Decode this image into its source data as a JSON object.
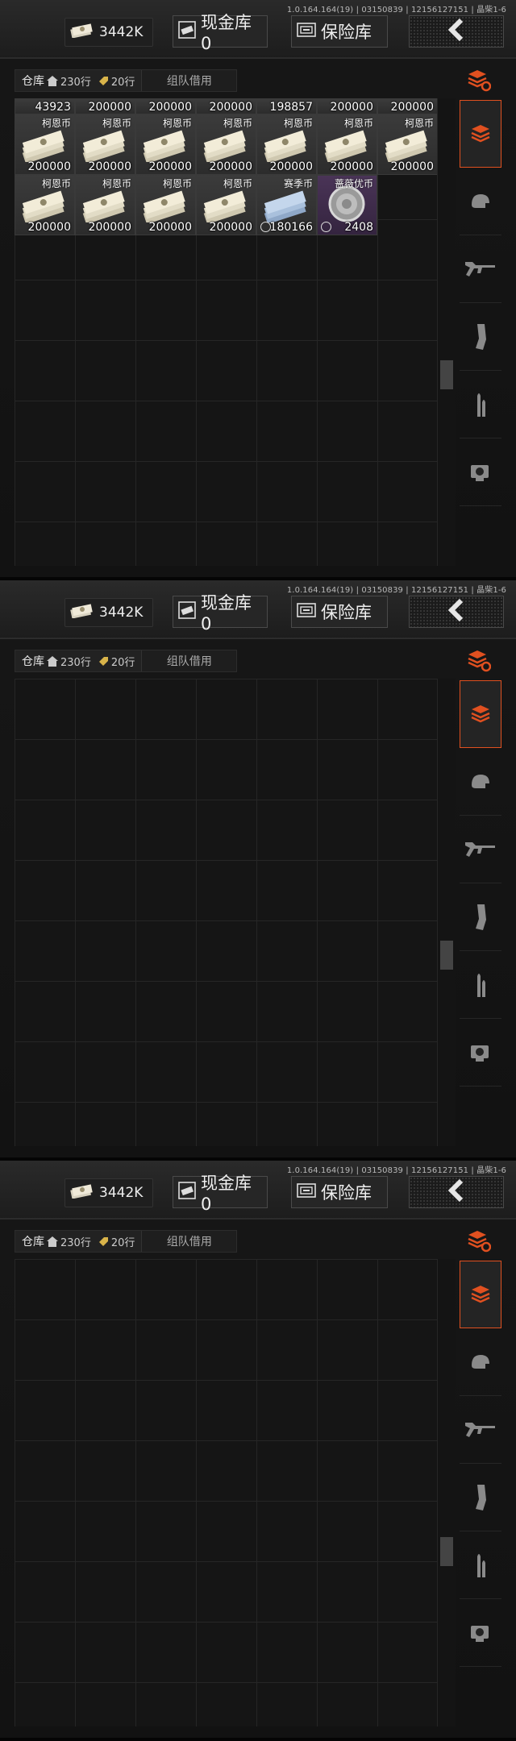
{
  "app": {
    "version": "1.0.164.164(19) | 03150839 | 12156127151 | 晶柴1-6"
  },
  "topbar": {
    "money_amount": "3442K",
    "cash_vault_label": "现金库 0",
    "safe_label": "保险库",
    "back_icon": "chevron-left-icon"
  },
  "tabs": {
    "warehouse_label": "仓库",
    "rows_230": "230行",
    "rows_20": "20行",
    "team_borrow_label": "组队借用"
  },
  "categories": [
    {
      "name": "all-items",
      "icon": "stack-icon"
    },
    {
      "name": "helmet",
      "icon": "helmet-icon"
    },
    {
      "name": "rifle",
      "icon": "rifle-icon"
    },
    {
      "name": "magazine",
      "icon": "magazine-icon"
    },
    {
      "name": "ammo",
      "icon": "bullet-icon"
    },
    {
      "name": "attachment",
      "icon": "sight-icon"
    }
  ],
  "panel1_items": {
    "row_top_partial": [
      "43923",
      "200000",
      "200000",
      "200000",
      "198857",
      "200000",
      "200000"
    ],
    "row_a": [
      {
        "name": "柯恩币",
        "qty": "200000"
      },
      {
        "name": "柯恩币",
        "qty": "200000"
      },
      {
        "name": "柯恩币",
        "qty": "200000"
      },
      {
        "name": "柯恩币",
        "qty": "200000"
      },
      {
        "name": "柯恩币",
        "qty": "200000"
      },
      {
        "name": "柯恩币",
        "qty": "200000"
      },
      {
        "name": "柯恩币",
        "qty": "200000"
      }
    ],
    "row_b": [
      {
        "name": "柯恩币",
        "qty": "200000"
      },
      {
        "name": "柯恩币",
        "qty": "200000"
      },
      {
        "name": "柯恩币",
        "qty": "200000"
      },
      {
        "name": "柯恩币",
        "qty": "200000"
      },
      {
        "name": "赛季币",
        "qty": "180166"
      },
      {
        "name": "蔷薇优币",
        "qty": "2408"
      }
    ]
  },
  "colors": {
    "accent": "#e05020",
    "item_purple": "#4a3457"
  }
}
